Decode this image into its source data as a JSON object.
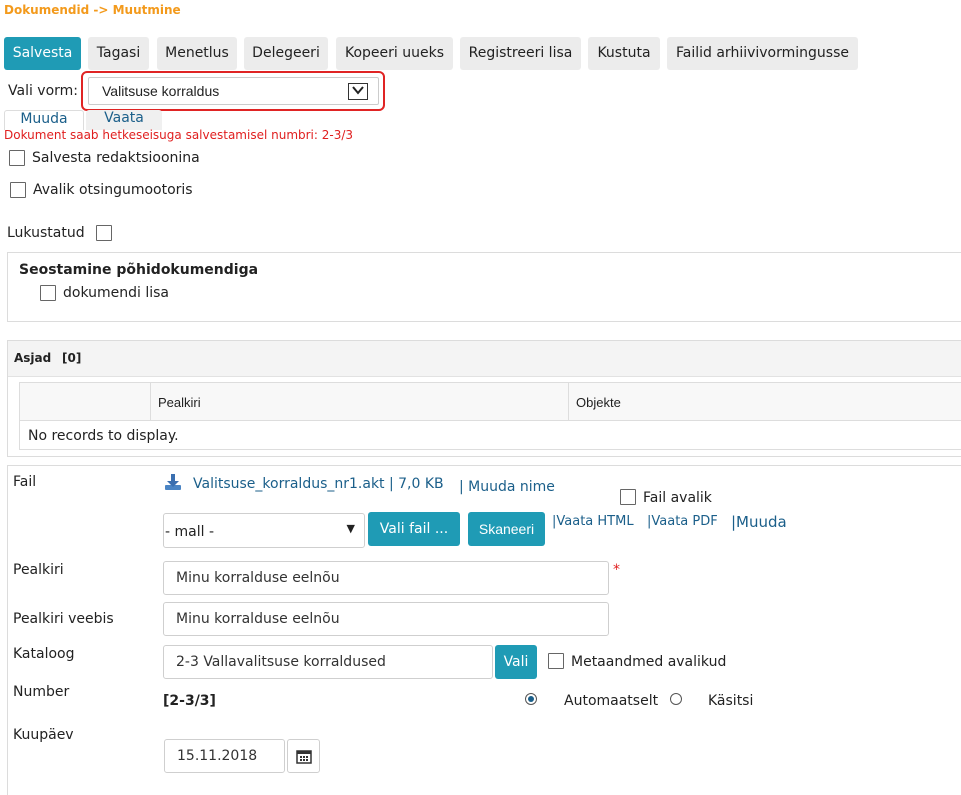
{
  "breadcrumb": "Dokumendid -> Muutmine",
  "toolbar": {
    "save": "Salvesta",
    "back": "Tagasi",
    "procedure": "Menetlus",
    "delegate": "Delegeeri",
    "copy_new": "Kopeeri uueks",
    "register_attachment": "Registreeri lisa",
    "delete": "Kustuta",
    "archive_files": "Failid arhiivivormingusse"
  },
  "form_select": {
    "label": "Vali vorm:",
    "selected": "Valitsuse korraldus"
  },
  "tabs": {
    "edit": "Muuda",
    "view": "Vaata"
  },
  "warning": "Dokument saab hetkeseisuga salvestamisel numbri: 2-3/3",
  "checkboxes": {
    "save_as_draft": "Salvesta redaktsioonina",
    "public_search": "Avalik otsingumootoris",
    "locked": "Lukustatud"
  },
  "link_section": {
    "title": "Seostamine põhidokumendiga",
    "doc_attachment": "dokumendi lisa"
  },
  "cases": {
    "title": "Asjad",
    "count": "[0]",
    "columns": [
      "Pealkiri",
      "Objekte"
    ],
    "empty": "No records to display."
  },
  "file": {
    "label": "Fail",
    "name": "Valitsuse_korraldus_nr1.akt | 7,0 KB",
    "rename": "| Muuda nime",
    "public_label": "Fail avalik",
    "template_select": "- mall -",
    "choose_file": "Vali fail ...",
    "scan": "Skaneeri",
    "view_html": "|Vaata HTML",
    "view_pdf": "|Vaata PDF",
    "edit": "|Muuda"
  },
  "title_field": {
    "label": "Pealkiri",
    "value": "Minu korralduse eelnõu",
    "required_mark": "*"
  },
  "web_title_field": {
    "label": "Pealkiri veebis",
    "value": "Minu korralduse eelnõu"
  },
  "catalog": {
    "label": "Kataloog",
    "value": "2-3 Vallavalitsuse korraldused",
    "choose": "Vali",
    "metadata_public": "Metaandmed avalikud"
  },
  "number": {
    "label": "Number",
    "value": "[2-3/3]",
    "auto": "Automaatselt",
    "manual": "Käsitsi",
    "auto_selected": true
  },
  "date": {
    "label": "Kuupäev",
    "value": "15.11.2018"
  }
}
